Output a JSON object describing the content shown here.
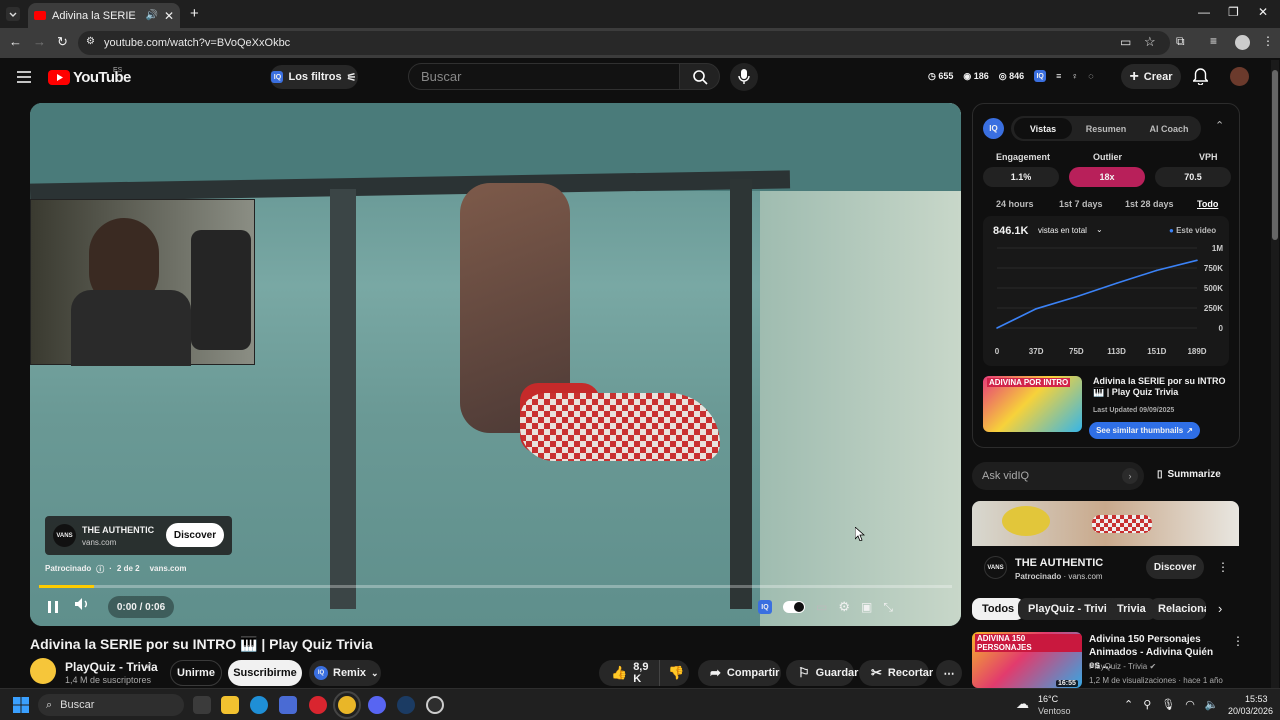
{
  "browser": {
    "tab_title": "Adivina la SERIE por su INT",
    "url": "youtube.com/watch?v=BVoQeXxOkbc"
  },
  "header": {
    "logo": "YouTube",
    "region": "ES",
    "filters_label": "Los filtros",
    "search_placeholder": "Buscar",
    "stat_views": "655",
    "stat_likes": "186",
    "stat_comments": "846",
    "create_label": "Crear"
  },
  "video": {
    "ad": {
      "brand": "THE AUTHENTIC",
      "domain": "vans.com",
      "discover_label": "Discover",
      "sponsored": "Patrocinado",
      "position": "2 de 2",
      "ad_domain": "vans.com"
    },
    "time": "0:00 / 0:06",
    "progress": 0.06,
    "title": "Adivina la SERIE por su INTRO 🎹 | Play Quiz Trivia"
  },
  "channel": {
    "name": "PlayQuiz - Trivia",
    "subscribers": "1,4 M de suscriptores",
    "join_label": "Unirme",
    "subscribe_label": "Suscribirme",
    "remix_label": "Remix"
  },
  "actions": {
    "likes": "8,9 K",
    "share": "Compartir",
    "save": "Guardar",
    "clip": "Recortar"
  },
  "vidiq": {
    "badge": "IQ",
    "tabs": [
      "Vistas",
      "Resumen",
      "AI Coach"
    ],
    "metrics": [
      {
        "label": "Engagement",
        "value": "1.1%"
      },
      {
        "label": "Outlier",
        "value": "18x"
      },
      {
        "label": "VPH",
        "value": "70.5"
      }
    ],
    "ranges": [
      "24 hours",
      "1st 7 days",
      "1st 28 days",
      "Todo"
    ],
    "total": "846.1K",
    "total_label": "vistas en total",
    "legend": "Este video",
    "thumb_title": "Adivina la SERIE por su INTRO 🎹 | Play Quiz Trivia",
    "last_updated": "Last Updated 09/09/2025",
    "similar_label": "See similar thumbnails",
    "thumb_text": "ADIVINA POR INTRO",
    "ask_placeholder": "Ask vidIQ",
    "summarize_label": "Summarize"
  },
  "chart_data": {
    "type": "line",
    "x": [
      0,
      37,
      75,
      113,
      151,
      189
    ],
    "xticks": [
      "0",
      "37D",
      "75D",
      "113D",
      "151D",
      "189D"
    ],
    "yticks": [
      "1M",
      "750K",
      "500K",
      "250K",
      "0"
    ],
    "ylim": [
      0,
      1000000
    ],
    "series": [
      {
        "name": "Este video",
        "values": [
          0,
          240000,
          390000,
          560000,
          720000,
          846100
        ]
      }
    ]
  },
  "side_ad": {
    "brand": "THE AUTHENTIC",
    "sponsored": "Patrocinado",
    "domain": "vans.com",
    "discover_label": "Discover"
  },
  "chips": [
    "Todos",
    "PlayQuiz - Trivia",
    "Trivia",
    "Relaciona"
  ],
  "recommended": {
    "title": "Adivina 150 Personajes Animados - Adivina Quién es ...",
    "channel": "PlayQuiz - Trivia",
    "meta": "1,2 M de visualizaciones · hace 1 año",
    "duration": "16:55",
    "thumb_text": "ADIVINA 150 PERSONAJES"
  },
  "taskbar": {
    "search": "Buscar",
    "temp": "16°C",
    "weather": "Ventoso",
    "time": "15:53",
    "date": "20/03/2026"
  }
}
